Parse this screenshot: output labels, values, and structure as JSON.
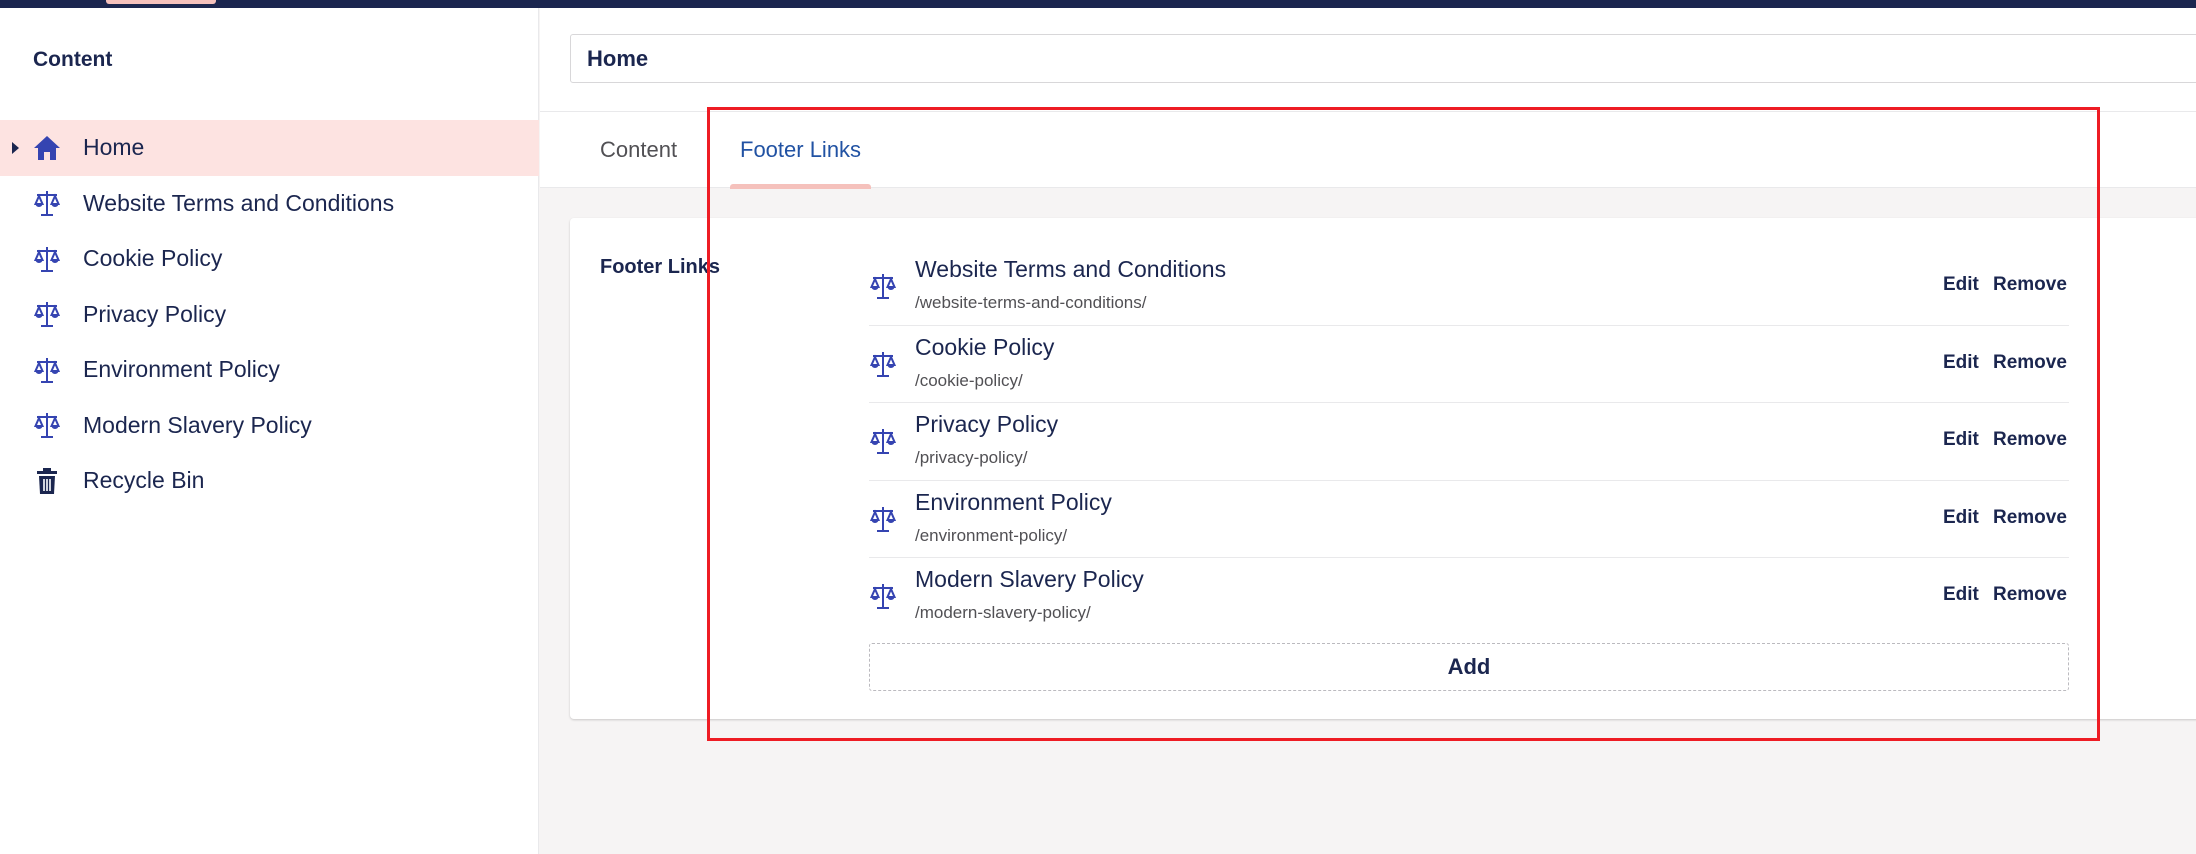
{
  "colors": {
    "navy": "#1b264f",
    "icon_blue": "#3544b1",
    "active_bg": "#fde3e1",
    "tab_active": "#2152a3",
    "highlight": "#ee1c24"
  },
  "sidebar": {
    "title": "Content",
    "items": [
      {
        "label": "Home",
        "icon": "house-icon",
        "active": true
      },
      {
        "label": "Website Terms and Conditions",
        "icon": "scales-icon"
      },
      {
        "label": "Cookie Policy",
        "icon": "scales-icon"
      },
      {
        "label": "Privacy Policy",
        "icon": "scales-icon"
      },
      {
        "label": "Environment Policy",
        "icon": "scales-icon"
      },
      {
        "label": "Modern Slavery Policy",
        "icon": "scales-icon"
      },
      {
        "label": "Recycle Bin",
        "icon": "trash-icon"
      }
    ]
  },
  "editor": {
    "node_name": "Home",
    "tabs": [
      {
        "label": "Content"
      },
      {
        "label": "Footer Links",
        "active": true
      }
    ],
    "property_label": "Footer Links",
    "links": [
      {
        "name": "Website Terms and Conditions",
        "path": "/website-terms-and-conditions/"
      },
      {
        "name": "Cookie Policy",
        "path": "/cookie-policy/"
      },
      {
        "name": "Privacy Policy",
        "path": "/privacy-policy/"
      },
      {
        "name": "Environment Policy",
        "path": "/environment-policy/"
      },
      {
        "name": "Modern Slavery Policy",
        "path": "/modern-slavery-policy/"
      }
    ],
    "edit_label": "Edit",
    "remove_label": "Remove",
    "add_label": "Add"
  }
}
